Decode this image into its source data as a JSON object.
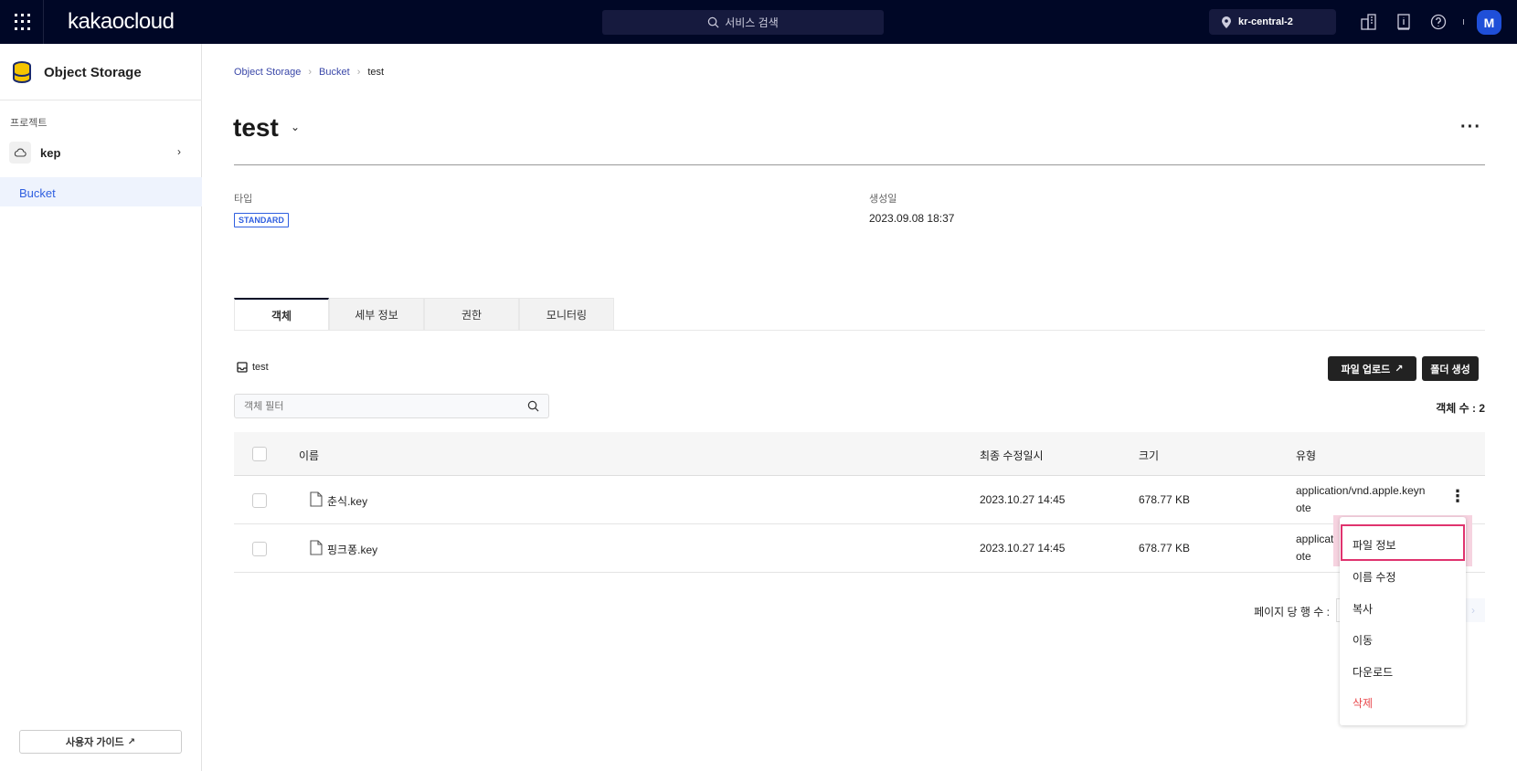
{
  "topbar": {
    "logo": "kakaocloud",
    "search_placeholder": "서비스 검색",
    "region": "kr-central-2",
    "avatar": "M"
  },
  "sidebar": {
    "service": "Object Storage",
    "section_label": "프로젝트",
    "project": "kep",
    "active_item": "Bucket",
    "guide_button": "사용자 가이드"
  },
  "breadcrumb": [
    "Object Storage",
    "Bucket",
    "test"
  ],
  "bucket": {
    "name": "test",
    "type_label": "타입",
    "type_value": "STANDARD",
    "created_label": "생성일",
    "created_value": "2023.09.08 18:37"
  },
  "tabs": [
    {
      "label": "객체",
      "active": true
    },
    {
      "label": "세부 정보"
    },
    {
      "label": "권한"
    },
    {
      "label": "모니터링"
    }
  ],
  "objects": {
    "folder": "test",
    "upload_button": "파일 업로드",
    "create_folder_button": "폴더 생성",
    "filter_placeholder": "객체 필터",
    "count_text": "객체 수 : 2",
    "columns": [
      "이름",
      "최종 수정일시",
      "크기",
      "유형"
    ],
    "rows": [
      {
        "name": "춘식.key",
        "modified": "2023.10.27 14:45",
        "size": "678.77 KB",
        "type1": "application/vnd.apple.keyn",
        "type2": "ote"
      },
      {
        "name": "핑크퐁.key",
        "modified": "2023.10.27 14:45",
        "size": "678.77 KB",
        "type1": "applicatio",
        "type2": "ote"
      }
    ],
    "rows_per_page_label": "페이지 당 행 수 :"
  },
  "context_menu": {
    "items": [
      "파일 정보",
      "이름 수정",
      "복사",
      "이동",
      "다운로드",
      "삭제"
    ],
    "highlighted": "파일 정보",
    "danger_color": "#e8474b"
  },
  "colors": {
    "topbar": "#000726",
    "accent": "#2f5fe0",
    "highlight": "#e0336e"
  }
}
